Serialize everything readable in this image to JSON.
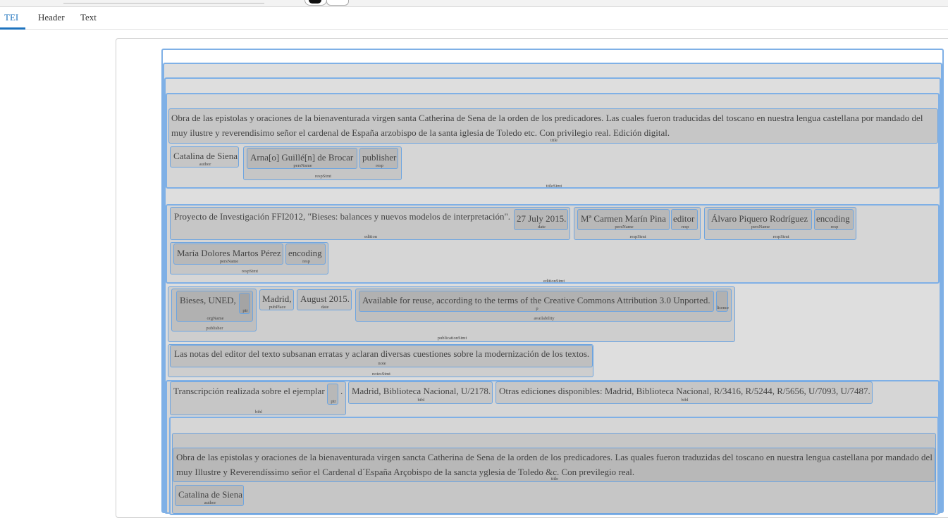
{
  "tabs": {
    "tei": "TEI",
    "header": "Header",
    "text": "Text"
  },
  "tags": {
    "title": "title",
    "author": "author",
    "persName": "persName",
    "resp": "resp",
    "respStmt": "respStmt",
    "titleStmt": "titleStmt",
    "edition": "edition",
    "date": "date",
    "editionStmt": "editionStmt",
    "ptr": "ptr",
    "orgName": "orgName",
    "publisher": "publisher",
    "pubPlace": "pubPlace",
    "p": "p",
    "licence": "licence",
    "availability": "availability",
    "publicationStmt": "publicationStmt",
    "note": "note",
    "notesStmt": "notesStmt",
    "bibl": "bibl"
  },
  "titleStmt": {
    "title": "Obra de las epistolas y oraciones de la bienaventurada virgen santa Catherina de Sena de la orden de los predicadores. Las cuales fueron traducidas del toscano en nuestra lengua castellana por mandado del muy ilustre y reverendisimo señor el cardenal de España arzobispo de la santa iglesia de Toledo etc. Con privilegio real. Edición digital.",
    "author": "Catalina de Siena",
    "persName": "Arna[o] Guillé[n] de Brocar",
    "resp": "publisher"
  },
  "editionStmt": {
    "edition": "Proyecto de Investigación FFI2012, \"Bieses: balances y nuevos modelos de interpretación\".",
    "date": "27 July 2015.",
    "editor_name": "Mª Carmen Marín Pina",
    "editor_resp": "editor",
    "encoder1_name": "Álvaro Piquero Rodríguez",
    "encoder1_resp": "encoding",
    "encoder2_name": "María Dolores Martos Pérez",
    "encoder2_resp": "encoding"
  },
  "publicationStmt": {
    "orgName": "Bieses, UNED,",
    "pubPlace": "Madrid,",
    "date": "August 2015.",
    "availability": "Available for reuse, according to the terms of the Creative Commons Attribution 3.0 Unported."
  },
  "notesStmt": {
    "note": "Las notas del editor del texto subsanan erratas y aclaran diversas cuestiones sobre la modernización de los textos."
  },
  "sourceDesc": {
    "bibl1": "Transcripción realizada sobre el ejemplar",
    "bibl1_dot": ".",
    "bibl2": "Madrid, Biblioteca Nacional, U/2178.",
    "bibl3": "Otras ediciones disponibles: Madrid, Biblioteca Nacional, R/3416, R/5244, R/5656, U/7093, U/7487.",
    "title2": "Obra de las epistolas y oraciones de la bienaventurada virgen sancta Catherina de Sena de la orden de los predicadores. Las quales fueron traduzidas del toscano en nuestra lengua castellana por mandado del muy Illustre y Reverendíssimo señor el Cardenal d´España Arçobispo de la sancta yglesia de Toledo &c. Con previlegio real.",
    "author2": "Catalina de Siena"
  }
}
